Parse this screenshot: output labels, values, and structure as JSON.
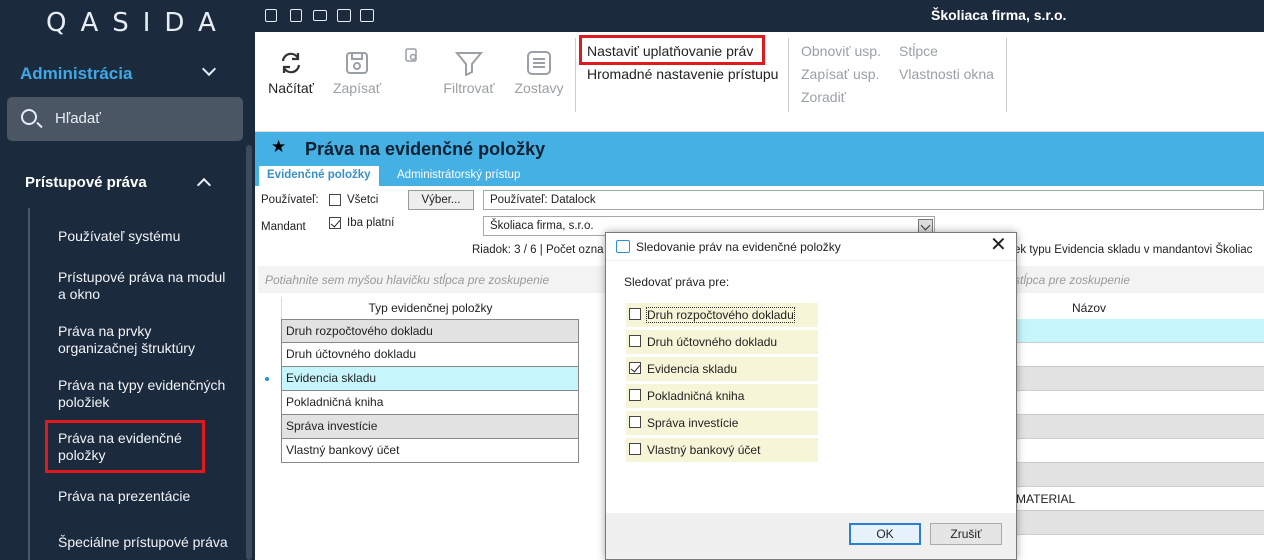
{
  "sidebar": {
    "logo": "QASIDA",
    "module_title": "Administrácia",
    "search_label": "Hľadať",
    "section_title": "Prístupové práva",
    "items": [
      {
        "label": "Používateľ systému"
      },
      {
        "label": "Prístupové práva na modul a okno"
      },
      {
        "label": "Práva na prvky organizačnej štruktúry"
      },
      {
        "label": "Práva na typy evidenčných položiek"
      },
      {
        "label": "Práva na evidenčné položky"
      },
      {
        "label": "Práva na prezentácie"
      },
      {
        "label": "Špeciálne prístupové práva"
      }
    ]
  },
  "topbar": {
    "company": "Školiaca firma, s.r.o.",
    "icons": [
      "excel-icon",
      "pdf-icon",
      "email-icon",
      "print-icon",
      "print-preview-icon"
    ]
  },
  "ribbon": {
    "nacitat": "Načítať",
    "zapisat": "Zapísať",
    "filtrovat": "Filtrovať",
    "zostavy": "Zostavy",
    "nastavit": "Nastaviť uplatňovanie práv",
    "hromadne": "Hromadné nastavenie prístupu",
    "obnovit": "Obnoviť usp.",
    "zapisat_usp": "Zapísať usp.",
    "zoradit": "Zoradiť",
    "stlpce": "Stĺpce",
    "vlastnosti": "Vlastnosti okna"
  },
  "page": {
    "title": "Práva na evidenčné položky",
    "tabs": [
      "Evidenčné položky",
      "Administrátorský prístup"
    ]
  },
  "filters": {
    "pouzivatel_label": "Používateľ:",
    "vsetci": "Všetci",
    "vyber": "Výber...",
    "pouzivatel_value": "Používateľ: Datalock",
    "mandant_label": "Mandant",
    "iba_platni": "Iba platní",
    "mandant_value": "Školiaca firma, s.r.o."
  },
  "status": {
    "left": "Riadok: 3 / 6 | Počet ozna",
    "right": "ek typu Evidencia skladu v mandantovi Školiac"
  },
  "grid": {
    "group_hint": "Potiahnite sem myšou hlavičku stĺpca pre zoskupenie",
    "group_hint_right": "stĺpca pre zoskupenie",
    "col_typ": "Typ evidenčnej položky",
    "col_nazov": "Názov",
    "rows": [
      {
        "typ": "Druh rozpočtového dokladu"
      },
      {
        "typ": "Druh účtovného dokladu"
      },
      {
        "typ": "Evidencia skladu"
      },
      {
        "typ": "Pokladničná kniha"
      },
      {
        "typ": "Správa investície"
      },
      {
        "typ": "Vlastný bankový účet"
      }
    ],
    "right_rows": [
      "",
      "",
      "",
      "",
      "",
      "",
      "",
      "MATERIAL",
      ""
    ]
  },
  "dialog": {
    "title": "Sledovanie práv na evidenčné položky",
    "subtitle": "Sledovať práva pre:",
    "items": [
      {
        "label": "Druh rozpočtového dokladu",
        "checked": false
      },
      {
        "label": "Druh účtovného dokladu",
        "checked": false
      },
      {
        "label": "Evidencia skladu",
        "checked": true
      },
      {
        "label": "Pokladničná kniha",
        "checked": false
      },
      {
        "label": "Správa investície",
        "checked": false
      },
      {
        "label": "Vlastný bankový účet",
        "checked": false
      }
    ],
    "ok": "OK",
    "cancel": "Zrušiť"
  },
  "colors": {
    "sidebar_bg": "#1b2a3c",
    "accent": "#45b0e4",
    "highlight": "#e0191f",
    "selected_row": "#c6f6fb"
  }
}
